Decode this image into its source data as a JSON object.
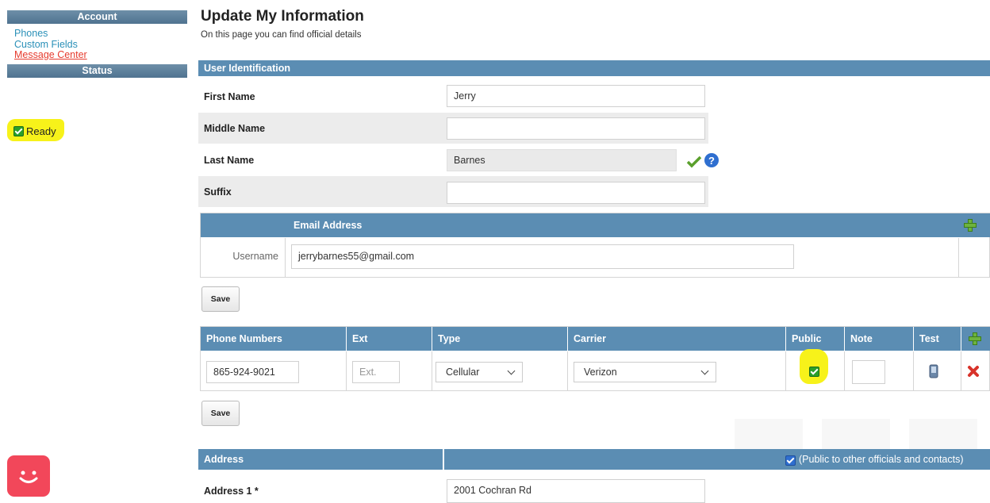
{
  "sidebar": {
    "account_heading": "Account",
    "links": [
      "Phones",
      "Custom Fields",
      "Message Center"
    ],
    "status_heading": "Status",
    "status_text": "Ready"
  },
  "page": {
    "title": "Update My Information",
    "subtitle": "On this page you can find official details"
  },
  "user_identification": {
    "heading": "User Identification",
    "fields": [
      {
        "label": "First Name",
        "value": "Jerry"
      },
      {
        "label": "Middle Name",
        "value": ""
      },
      {
        "label": "Last Name",
        "value": "Barnes"
      },
      {
        "label": "Suffix",
        "value": ""
      }
    ]
  },
  "email": {
    "heading": "Email Address",
    "row_label": "Username",
    "value": "jerrybarnes55@gmail.com",
    "save_label": "Save"
  },
  "phones": {
    "headers": [
      "Phone Numbers",
      "Ext",
      "Type",
      "Carrier",
      "Public",
      "Note",
      "Test"
    ],
    "row": {
      "number": "865-924-9021",
      "ext_placeholder": "Ext.",
      "type": "Cellular",
      "carrier": "Verizon",
      "public": true
    },
    "save_label": "Save"
  },
  "address": {
    "heading": "Address",
    "public_label": "(Public to other officials and contacts)",
    "fields": [
      {
        "label": "Address 1 *",
        "value": "2001 Cochran Rd"
      }
    ]
  },
  "colors": {
    "header_blue": "#5b8db3",
    "highlight_yellow": "#f7f21a",
    "link_blue": "#2a90b8",
    "link_red": "#e63b2e"
  }
}
